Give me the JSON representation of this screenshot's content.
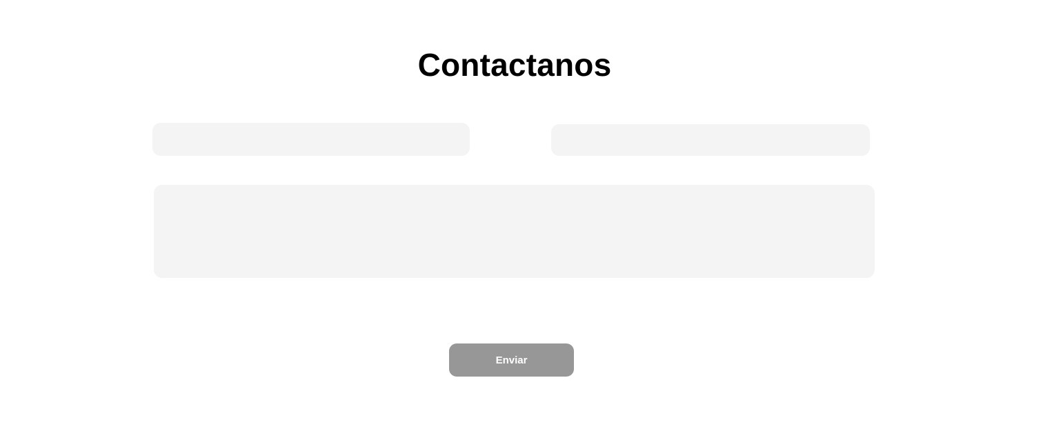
{
  "contact_form": {
    "title": "Contactanos",
    "name_field": {
      "value": "",
      "placeholder": ""
    },
    "email_field": {
      "value": "",
      "placeholder": ""
    },
    "message_field": {
      "value": "",
      "placeholder": ""
    },
    "submit_label": "Enviar"
  },
  "colors": {
    "background": "#ffffff",
    "title_text": "#000000",
    "field_background": "#f4f4f4",
    "button_background": "#979797",
    "button_text": "#ffffff"
  }
}
